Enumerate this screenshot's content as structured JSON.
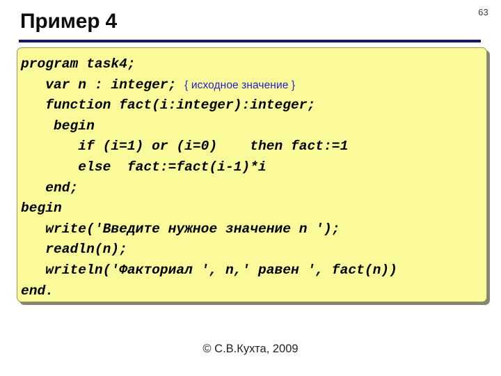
{
  "slide": {
    "page_number": "63",
    "title": "Пример 4",
    "footer": "© С.В.Кухта, 2009",
    "accent_rule_color": "#16166E",
    "card_background": "#FAFA9B",
    "card_border": "#9A9A55",
    "comment_color": "#2222CC",
    "title_color": "#0D0D0D"
  },
  "code": {
    "language": "Pascal",
    "lines": [
      {
        "text": "program task4;"
      },
      {
        "text": "   var n : integer; ",
        "comment": "{ исходное значение }"
      },
      {
        "text": "   function fact(i:integer):integer;"
      },
      {
        "text": "    begin"
      },
      {
        "text": "       if (i=1) or (i=0)    then fact:=1"
      },
      {
        "text": "       else  fact:=fact(i-1)*i"
      },
      {
        "text": "   end;"
      },
      {
        "text": "begin"
      },
      {
        "text": "   write('Введите нужное значение n ');"
      },
      {
        "text": "   readln(n);"
      },
      {
        "text": "   writeln('Факториал ', n,' равен ', fact(n))"
      },
      {
        "text": "end."
      }
    ]
  }
}
